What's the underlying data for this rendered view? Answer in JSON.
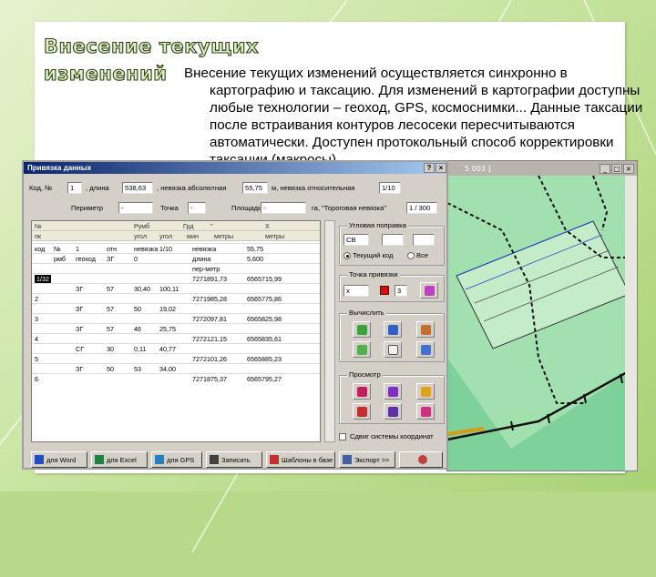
{
  "slide": {
    "title_lines": [
      "Внесение текущих",
      "изменений"
    ],
    "paragraph_lines": [
      "Внесение текущих изменений осуществляется синхронно в",
      "картографию и таксацию. Для изменений в картографии доступны",
      "любые технологии – геоход, GPS, космоснимки... Данные таксации",
      "после встраивания контуров лесосеки пересчитываются",
      "автоматически. Доступен протокольный способ корректировки",
      "таксации (макросы)."
    ]
  },
  "map_window": {
    "title": "5 003 ]"
  },
  "dialog": {
    "title": "Привязка данных",
    "fields": {
      "kod_label": "Код, №",
      "kod_value": "1",
      "dlina_label": ", длина",
      "dlina_value": "538,63",
      "nevyazka_abs_label": ", невязка абсолютная",
      "nevyazka_abs_value": "55,75",
      "nevyazka_otn_label": "м, невязка относительная",
      "nevyazka_otn_value": "1/10",
      "perimetr_label": "Периметр",
      "perimetr_value": "-",
      "tochka_label": "Точка",
      "tochka_value": "-",
      "ploshad_label": "Площадь",
      "ploshad_value": "-",
      "ga_label": "га, \"Тороговая невязка\"",
      "ga_value": "1 / 300"
    },
    "grid": {
      "header1": [
        "№",
        "Румб",
        "Грд",
        "\"",
        "X"
      ],
      "header2": [
        "пк",
        "угол",
        "угол",
        "мин",
        "метры",
        "метры"
      ],
      "rows": [
        {
          "id": "код",
          "n": "№",
          "a": "1",
          "b": "отн",
          "c": "невязка",
          "d": "1/10",
          "e": "невязка",
          "f": "55,75"
        },
        {
          "id": "",
          "n": "рмб",
          "a": "геоход",
          "b": "ЗГ",
          "c": "0",
          "d": "",
          "e": "длина",
          "f": "5,600"
        },
        {
          "id": "",
          "n": "",
          "a": "",
          "b": "",
          "c": "",
          "d": "",
          "e": "пер-метр",
          "f": ""
        },
        {
          "id": "1/32",
          "n": "",
          "a": "",
          "b": "",
          "c": "",
          "d": "",
          "e": "7271891,73",
          "f": "6565715,99"
        },
        {
          "id": "",
          "n": "",
          "a": "ЗГ",
          "b": "57",
          "c": "30,40",
          "d": "100,11",
          "e": "",
          "f": ""
        },
        {
          "id": "2",
          "n": "",
          "a": "",
          "b": "",
          "c": "",
          "d": "",
          "e": "7271985,28",
          "f": "6565775,86"
        },
        {
          "id": "",
          "n": "",
          "a": "ЗГ",
          "b": "57",
          "c": "50",
          "d": "19,02",
          "e": "",
          "f": ""
        },
        {
          "id": "3",
          "n": "",
          "a": "",
          "b": "",
          "c": "",
          "d": "",
          "e": "7272097,81",
          "f": "6565825,98"
        },
        {
          "id": "",
          "n": "",
          "a": "ЗГ",
          "b": "57",
          "c": "46",
          "d": "25,75",
          "e": "",
          "f": ""
        },
        {
          "id": "4",
          "n": "",
          "a": "",
          "b": "",
          "c": "",
          "d": "",
          "e": "7272121,15",
          "f": "6565835,61"
        },
        {
          "id": "",
          "n": "",
          "a": "СГ",
          "b": "30",
          "c": "0,11",
          "d": "40,77",
          "e": "",
          "f": ""
        },
        {
          "id": "5",
          "n": "",
          "a": "",
          "b": "",
          "c": "",
          "d": "",
          "e": "7272101,26",
          "f": "6565885,23"
        },
        {
          "id": "",
          "n": "",
          "a": "ЗГ",
          "b": "50",
          "c": "53",
          "d": "34,00",
          "e": "",
          "f": ""
        },
        {
          "id": "6",
          "n": "",
          "a": "",
          "b": "",
          "c": "",
          "d": "",
          "e": "7271875,37",
          "f": "6565795,27"
        }
      ]
    },
    "groups": {
      "uglovaya": "Угловая поправка",
      "ugol_select": "СВ",
      "radio1": "Текущий код",
      "radio2": "Все",
      "tochka_privyazki": "Точка привязки",
      "tochka_select": "х",
      "tochka_num": "3",
      "vychislit": "Вычислить",
      "prosmotr": "Просмотр",
      "sdvig": "Сдвиг системы координат"
    },
    "buttons": [
      "для Word",
      "для Excel",
      "для GPS",
      "Записать",
      "Шаблоны в базе",
      "Экспорт >>"
    ]
  }
}
